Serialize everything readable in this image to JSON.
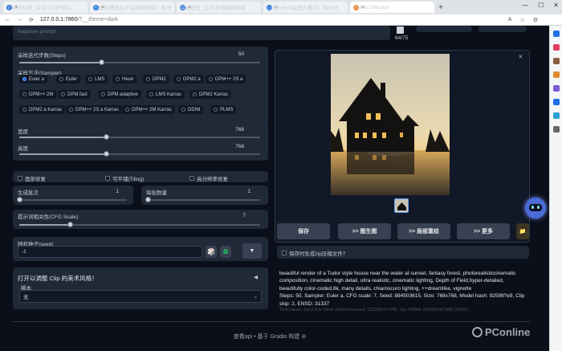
{
  "browser": {
    "tabs": [
      {
        "label": "太平洋科技_专业IT门户网站",
        "color": "#1e6fe8"
      },
      {
        "label": "不仅免费而且不受网络限制！本地",
        "color": "#1e6fe8"
      },
      {
        "label": "搞机运营_太平洋电脑网视频",
        "color": "#1e6fe8"
      },
      {
        "label": "15张N卡AI绘图大横评！帮你才",
        "color": "#1e6fe8"
      },
      {
        "label": "Stable Diffusion",
        "color": "#f08a24"
      }
    ],
    "new_tab": "+",
    "close_glyph": "×",
    "window_controls": [
      "—",
      "☐",
      "✕"
    ],
    "nav": [
      "←",
      "→",
      "⟳"
    ],
    "url_main": "127.0.0.1:7860",
    "url_suffix": "/?__theme=dark",
    "right_icons": [
      "A",
      "☆",
      "⚙"
    ]
  },
  "edge_bar": [
    {
      "icon": "search-icon",
      "color": "#1e6fe8"
    },
    {
      "icon": "tag-icon",
      "color": "#e53e5e"
    },
    {
      "icon": "briefcase-icon",
      "color": "#8b5e3c"
    },
    {
      "icon": "puzzle-icon",
      "color": "#e08a2a"
    },
    {
      "icon": "circle-icon",
      "color": "#7b5cd6"
    },
    {
      "icon": "outlook-icon",
      "color": "#1e6fe8"
    },
    {
      "icon": "paper-plane-icon",
      "color": "#2a9fd6"
    },
    {
      "icon": "plus-icon",
      "color": "#666666"
    }
  ],
  "prompt": {
    "negative_placeholder": "Negative prompt",
    "counter": "64/75"
  },
  "steps": {
    "label": "采样迭代步数(Steps)",
    "value": "50",
    "fraction": 0.34
  },
  "sampler": {
    "label": "采样方法(Sampler)",
    "options": [
      {
        "label": "Euler a",
        "selected": true
      },
      {
        "label": "Euler",
        "selected": false
      },
      {
        "label": "LMS",
        "selected": false
      },
      {
        "label": "Heun",
        "selected": false
      },
      {
        "label": "DPM2",
        "selected": false
      },
      {
        "label": "DPM2 a",
        "selected": false
      },
      {
        "label": "DPM++ 2S a",
        "selected": false
      },
      {
        "label": "DPM++ 2M",
        "selected": false
      },
      {
        "label": "DPM fast",
        "selected": false
      },
      {
        "label": "DPM adaptive",
        "selected": false
      },
      {
        "label": "LMS Karras",
        "selected": false
      },
      {
        "label": "DPM2 Karras",
        "selected": false
      },
      {
        "label": "DPM2 a Karras",
        "selected": false
      },
      {
        "label": "DPM++ 2S a Karras",
        "selected": false
      },
      {
        "label": "DPM++ 2M Karras",
        "selected": false
      },
      {
        "label": "DDIM",
        "selected": false
      },
      {
        "label": "PLMS",
        "selected": false
      }
    ]
  },
  "width": {
    "label": "宽度",
    "value": "768",
    "fraction": 0.36
  },
  "height": {
    "label": "高度",
    "value": "768",
    "fraction": 0.36
  },
  "options": {
    "face_restore": "面部修复",
    "tiling": "可平铺(Tiling)",
    "hires_fix": "高分辨率修复"
  },
  "batch_count": {
    "label": "生成批次",
    "value": "1",
    "fraction": 0.0
  },
  "batch_size": {
    "label": "每批数量",
    "value": "1",
    "fraction": 0.0
  },
  "cfg": {
    "label": "提示词相关性(CFG Scale)",
    "value": "7",
    "fraction": 0.21
  },
  "seed": {
    "label": "随机种子(seed)",
    "value": "-1",
    "dice": "🎲",
    "recycle": "♻",
    "extra": "▼"
  },
  "script_panel": {
    "clip_toggle": "打开以调整 Clip 的美术风格！",
    "toggle_glyph": "◀",
    "script_label": "脚本",
    "script_value": "无",
    "chevron": "⌄"
  },
  "gallery": {
    "close": "×"
  },
  "actions": {
    "save": "保存",
    "img2img": ">> 图生图",
    "inpaint": ">> 局部重绘",
    "more": ">> 更多",
    "folder": "📁"
  },
  "zip_option": "保存时生成zip压缩文件？",
  "output_text": "beautiful render of a Tudor style house near the water at sunset, fantasy forest. photorealisticcinematic composition, cinematic high detail, ultra realistic, cinematic lighting, Depth of Field,hyper-detailed, beautifully color-coded,8k, many details, chiaroscuro lighting, ++dreamlike, vignette",
  "output_params": "Steps: 50, Sampler: Euler a, CFG scale: 7, Seed: 884503615, Size: 768x768, Model hash: 92599?e9, Clip skip: 2, ENSD: 31337",
  "timing_faded": "Time taken: 1m 8.53s  Torch active/reserved: 5213/6574 MiB, Sys VRAM: 8264/8192 MiB (100%)",
  "footer": "查看api • 基于 Gradio 构建 ⊚",
  "watermark": "PConline"
}
